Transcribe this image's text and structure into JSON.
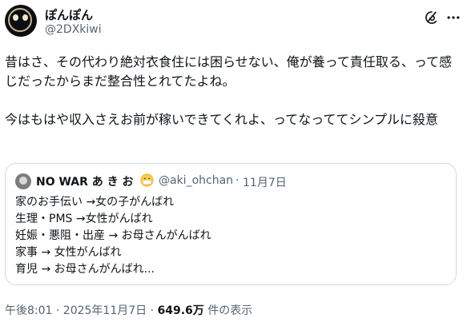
{
  "author": {
    "display_name": "ぽんぽん",
    "handle": "@2DXkiwi"
  },
  "icons": {
    "avatar": "cartoon-face-avatar",
    "grok": "grok-icon",
    "more": "more-options-icon",
    "quote_emoji": "mask-face-emoji"
  },
  "tweet": {
    "text": "昔はさ、その代わり絶対衣食住には困らせない、俺が養って責任取る、って感じだったからまだ整合性とれてたよね。\n\n今はもはや収入さえお前が稼いできてくれよ、ってなっててシンプルに殺意"
  },
  "quote": {
    "display_name": "NO WAR あ き お",
    "handle": "@aki_ohchan",
    "separator": "·",
    "date": "11月7日",
    "lines": [
      "家のお手伝い →女の子がんばれ",
      "生理・PMS →女性がんばれ",
      "妊娠・悪阻・出産 → お母さんがんばれ",
      "家事 → 女性がんばれ",
      "育児 → お母さんがんばれ..."
    ]
  },
  "footer": {
    "timestamp": "午後8:01 · 2025年11月7日 · ",
    "views": "649.6万",
    "views_suffix": " 件の表示"
  },
  "colors": {
    "text": "#0f1419",
    "secondary": "#536471",
    "border": "#cfd9de"
  }
}
